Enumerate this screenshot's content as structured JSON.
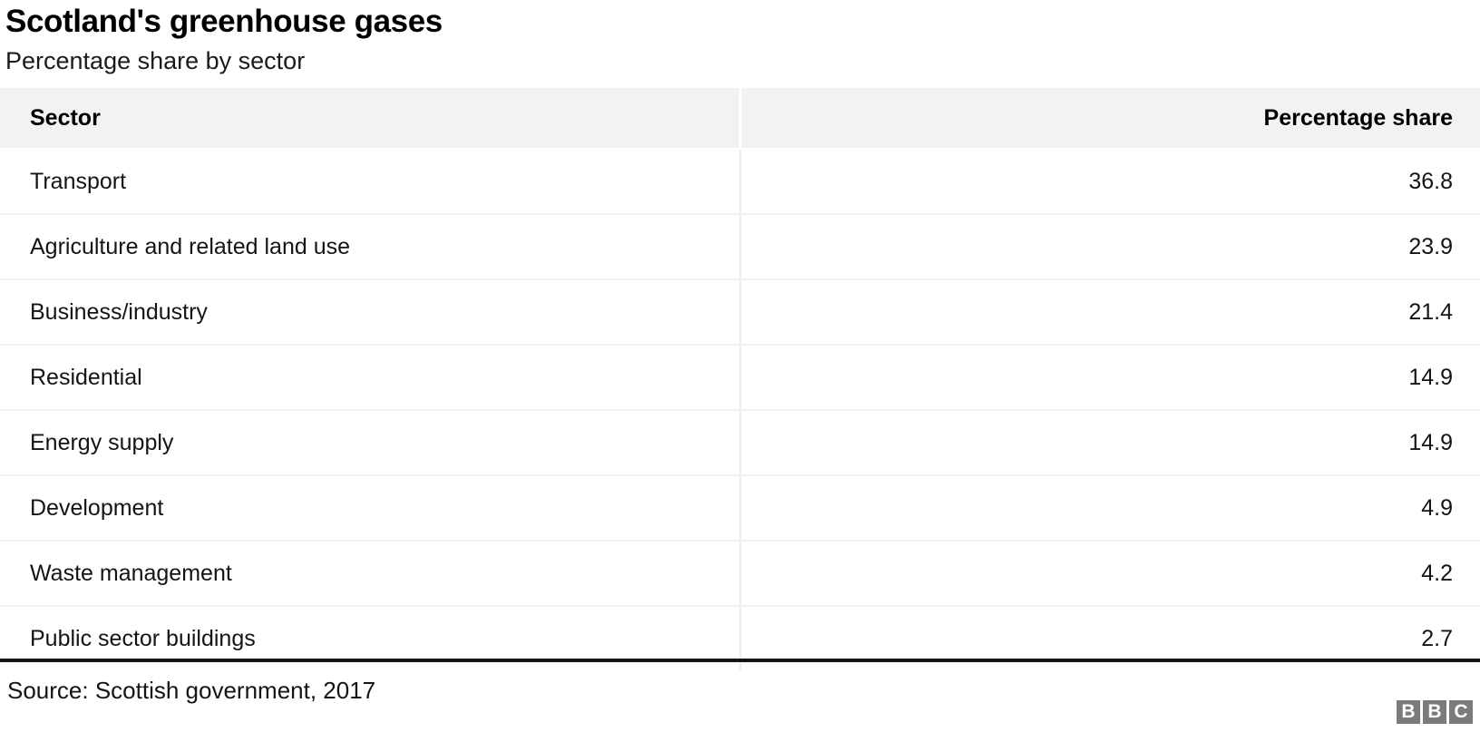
{
  "header": {
    "title": "Scotland's greenhouse gases",
    "subtitle": "Percentage share by sector"
  },
  "footer": {
    "source": "Source: Scottish government, 2017",
    "logo_letters": [
      "B",
      "B",
      "C"
    ]
  },
  "colors": {
    "header_band": "#f2f2f2",
    "row_divider": "#f0f0f0",
    "footer_rule": "#141414",
    "logo_block": "#7b7b7b",
    "text": "#141414"
  },
  "chart_data": {
    "type": "table",
    "title": "Scotland's greenhouse gases",
    "subtitle": "Percentage share by sector",
    "columns": [
      "Sector",
      "Percentage share"
    ],
    "categories": [
      "Transport",
      "Agriculture and related land use",
      "Business/industry",
      "Residential",
      "Energy supply",
      "Development",
      "Waste management",
      "Public sector buildings"
    ],
    "values": [
      36.8,
      23.9,
      21.4,
      14.9,
      14.9,
      4.9,
      4.2,
      2.7
    ],
    "rows": [
      {
        "sector": "Transport",
        "value": "36.8"
      },
      {
        "sector": "Agriculture and related land use",
        "value": "23.9"
      },
      {
        "sector": "Business/industry",
        "value": "21.4"
      },
      {
        "sector": "Residential",
        "value": "14.9"
      },
      {
        "sector": "Energy supply",
        "value": "14.9"
      },
      {
        "sector": "Development",
        "value": "4.9"
      },
      {
        "sector": "Waste management",
        "value": "4.2"
      },
      {
        "sector": "Public sector buildings",
        "value": "2.7"
      }
    ],
    "xlabel": "Sector",
    "ylabel": "Percentage share",
    "source": "Source: Scottish government, 2017"
  }
}
